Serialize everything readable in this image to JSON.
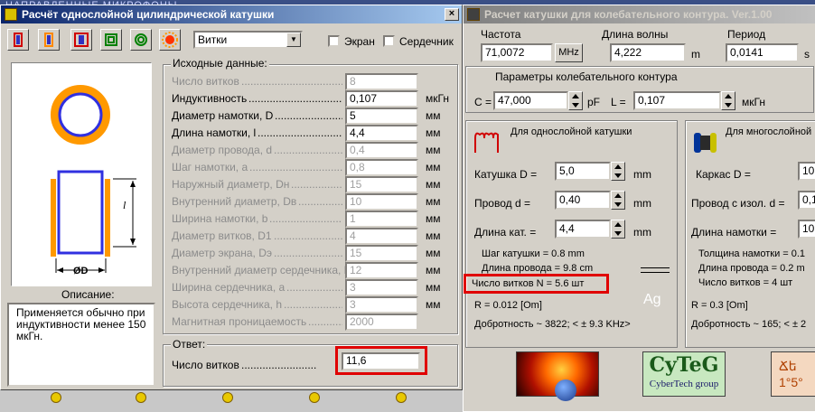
{
  "background": {
    "text": "НАПРАВЛЕННЫЕ  МИКРОФОНЫ"
  },
  "window1": {
    "title": "Расчёт однослойной цилиндрической катушки",
    "close": "×",
    "mode_select": "Витки",
    "screen_label": "Экран",
    "core_label": "Сердечник",
    "input_group_title": "Исходные данные:",
    "rows": [
      {
        "label": "Число витков",
        "value": "8",
        "unit": "",
        "enabled": false
      },
      {
        "label": "Индуктивность",
        "value": "0,107",
        "unit": "мкГн",
        "enabled": true
      },
      {
        "label": "Диаметр намотки, D",
        "value": "5",
        "unit": "мм",
        "enabled": true
      },
      {
        "label": "Длина намотки, l",
        "value": "4,4",
        "unit": "мм",
        "enabled": true
      },
      {
        "label": "Диаметр провода, d",
        "value": "0,4",
        "unit": "мм",
        "enabled": false
      },
      {
        "label": "Шаг намотки, a",
        "value": "0,8",
        "unit": "мм",
        "enabled": false
      },
      {
        "label": "Наружный диаметр, Dн",
        "value": "15",
        "unit": "мм",
        "enabled": false
      },
      {
        "label": "Внутренний диаметр, Dв",
        "value": "10",
        "unit": "мм",
        "enabled": false
      },
      {
        "label": "Ширина намотки, b",
        "value": "1",
        "unit": "мм",
        "enabled": false
      },
      {
        "label": "Диаметр витков, D1",
        "value": "4",
        "unit": "мм",
        "enabled": false
      },
      {
        "label": "Диаметр экрана, Dэ",
        "value": "15",
        "unit": "мм",
        "enabled": false
      },
      {
        "label": "Внутренний диаметр сердечника, D",
        "value": "12",
        "unit": "мм",
        "enabled": false
      },
      {
        "label": "Ширина сердечника, a",
        "value": "3",
        "unit": "мм",
        "enabled": false
      },
      {
        "label": "Высота сердечника, h",
        "value": "3",
        "unit": "мм",
        "enabled": false
      },
      {
        "label": "Магнитная проницаемость",
        "value": "2000",
        "unit": "",
        "enabled": false
      }
    ],
    "diagram_l": "l",
    "diagram_d": "ØD",
    "description_title": "Описание:",
    "description_text": "Применяется обычно при индуктивности менее 150 мкГн.",
    "answer_title": "Ответ:",
    "answer_label": "Число витков",
    "answer_value": "11,6"
  },
  "window2": {
    "title": "Расчет катушки для колебательного контура. Ver.1.00",
    "freq_label": "Частота",
    "freq_value": "71,0072",
    "freq_unit": "MHz",
    "wave_label": "Длина волны",
    "wave_value": "4,222",
    "wave_unit": "m",
    "period_label": "Период",
    "period_value": "0,0141",
    "period_unit": "s",
    "circuit_title": "Параметры колебательного контура",
    "c_label": "C =",
    "c_value": "47,000",
    "c_unit": "pF",
    "l_label": "L =",
    "l_value": "0,107",
    "l_unit": "мкГн",
    "single": {
      "title": "Для однослойной катушки",
      "coil_label": "Катушка D =",
      "coil_value": "5,0",
      "coil_unit": "mm",
      "wire_label": "Провод  d =",
      "wire_value": "0,40",
      "wire_unit": "mm",
      "len_label": "Длина кат. =",
      "len_value": "4,4",
      "len_unit": "mm",
      "pitch_text": "Шаг  катушки =   0.8 mm",
      "wire_len_text": "Длина провода =   9.8 cm",
      "turns_text": "Число витков N =    5.6 шт",
      "r_text": "R =  0.012 [Om]",
      "q_text": "Добротность ~   3822; < ±   9.3 KHz>",
      "material": "Ag"
    },
    "multi": {
      "title": "Для многослойной",
      "frame_label": "Каркас   D  =",
      "frame_value": "10,",
      "wire_label": "Провод с изол. d =",
      "wire_value": "0,1",
      "len_label": "Длина намотки   =",
      "len_value": "10,",
      "thick_text": "Толщина намотки  =  0.1",
      "wire_len_text": "Длина провода =  0.2 m",
      "turns_text": "Число витков =    4 шт",
      "r_text": "R =  0.3 [Om]",
      "q_text": "Добротность ~   165; < ± 2"
    },
    "logo_text": "CyTeG",
    "logo_sub": "CyberTech group",
    "right_logo_text": "Ճե\n1°5°"
  },
  "colors": {
    "title_active": "#0a246a",
    "highlight": "#e00000",
    "coil_orange": "#ff9900",
    "coil_blue": "#3030e0"
  }
}
